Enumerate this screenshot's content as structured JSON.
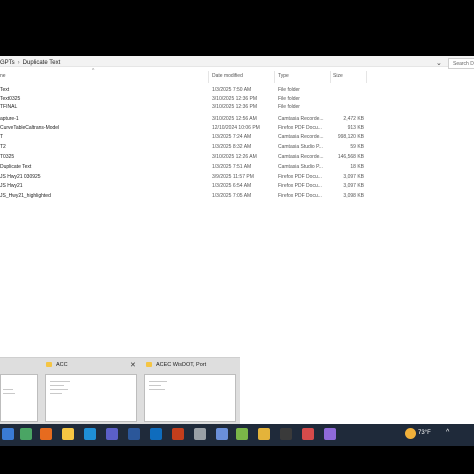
{
  "explorer": {
    "breadcrumb": [
      "GPTs",
      "Duplicate Text"
    ],
    "search_placeholder": "Search D",
    "columns": {
      "name": "ne",
      "date": "Date modified",
      "type": "Type",
      "size": "Size"
    },
    "rows": [
      {
        "name": "Text",
        "date": "1/3/2025 7:50 AM",
        "type": "File folder",
        "size": ""
      },
      {
        "name": "Text0325",
        "date": "3/10/2025 12:36 PM",
        "type": "File folder",
        "size": ""
      },
      {
        "name": "TFINAL",
        "date": "3/10/2025 12:36 PM",
        "type": "File folder",
        "size": ""
      },
      {
        "name": "apture-1",
        "date": "3/10/2025 12:56 AM",
        "type": "Camtasia Recorde...",
        "size": "2,472 KB"
      },
      {
        "name": "CurveTableCaltrans-Model",
        "date": "12/10/2024 10:06 PM",
        "type": "Firefox PDF Docu...",
        "size": "913 KB"
      },
      {
        "name": "T",
        "date": "1/3/2025 7:24 AM",
        "type": "Camtasia Recorde...",
        "size": "998,120 KB"
      },
      {
        "name": "T2",
        "date": "1/3/2025 8:32 AM",
        "type": "Camtasia Studio P...",
        "size": "59 KB"
      },
      {
        "name": "T0325",
        "date": "3/10/2025 12:26 AM",
        "type": "Camtasia Recorde...",
        "size": "146,568 KB"
      },
      {
        "name": "Duplicate Text",
        "date": "1/3/2025 7:51 AM",
        "type": "Camtasia Studio P...",
        "size": "18 KB"
      },
      {
        "name": "JS Hwy21 030925",
        "date": "3/9/2025 11:57 PM",
        "type": "Firefox PDF Docu...",
        "size": "3,097 KB"
      },
      {
        "name": "JS Hwy21",
        "date": "1/3/2025 6:54 AM",
        "type": "Firefox PDF Docu...",
        "size": "3,097 KB"
      },
      {
        "name": "JS_Hwy21_highlighted",
        "date": "1/3/2025 7:05 AM",
        "type": "Firefox PDF Docu...",
        "size": "3,098 KB"
      }
    ]
  },
  "thumbnails": [
    {
      "title": "ACC"
    },
    {
      "title": "ACEC WisDOT, Port"
    }
  ],
  "taskbar": {
    "weather": "73°F",
    "icons": [
      {
        "name": "start-icon",
        "color": "#3a7bd5"
      },
      {
        "name": "camtasia-icon",
        "color": "#4aa564"
      },
      {
        "name": "firefox-icon",
        "color": "#e66b1f"
      },
      {
        "name": "file-explorer-icon",
        "color": "#f5c543"
      },
      {
        "name": "edge-icon",
        "color": "#1f8fd6"
      },
      {
        "name": "teams-icon",
        "color": "#5b5fc7"
      },
      {
        "name": "word-icon",
        "color": "#2b579a"
      },
      {
        "name": "outlook-icon",
        "color": "#0f6cbd"
      },
      {
        "name": "powerpoint-icon",
        "color": "#c43e1c"
      },
      {
        "name": "settings-icon",
        "color": "#9aa0a6"
      },
      {
        "name": "snipping-icon",
        "color": "#6a8fd9"
      },
      {
        "name": "notes-icon",
        "color": "#7ab648"
      },
      {
        "name": "chrome-icon",
        "color": "#e4b33a"
      },
      {
        "name": "terminal-icon",
        "color": "#3a3a3a"
      },
      {
        "name": "app-icon",
        "color": "#d64b4b"
      },
      {
        "name": "paint-icon",
        "color": "#8f6ad9"
      }
    ]
  }
}
